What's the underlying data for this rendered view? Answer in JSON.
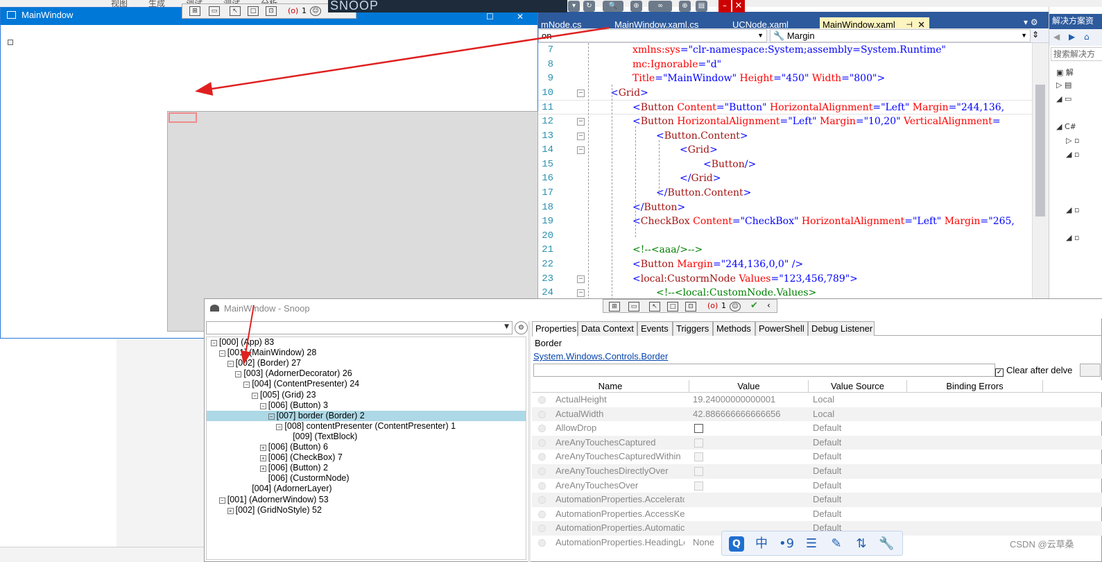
{
  "background": {
    "menu_items": [
      "视图",
      "生成",
      "调试",
      "测试",
      "分析"
    ]
  },
  "snoop_banner": {
    "title": "SNOOP"
  },
  "main_window": {
    "title": "MainWindow"
  },
  "vs": {
    "tabs": [
      {
        "label": "mNode.cs",
        "active": false
      },
      {
        "label": "MainWindow.xaml.cs",
        "active": false
      },
      {
        "label": "UCNode.xaml",
        "active": false
      },
      {
        "label": "MainWindow.xaml",
        "active": true
      }
    ],
    "active_tab_pin": "⊣",
    "active_tab_close": "✕",
    "left_dropdown": "on",
    "right_dropdown": "Margin",
    "code_lines": [
      {
        "n": "7",
        "fold": false
      },
      {
        "n": "8",
        "fold": false
      },
      {
        "n": "9",
        "fold": false
      },
      {
        "n": "10",
        "fold": true
      },
      {
        "n": "11",
        "fold": false
      },
      {
        "n": "12",
        "fold": true
      },
      {
        "n": "13",
        "fold": true
      },
      {
        "n": "14",
        "fold": true
      },
      {
        "n": "15",
        "fold": false
      },
      {
        "n": "16",
        "fold": false
      },
      {
        "n": "17",
        "fold": false
      },
      {
        "n": "18",
        "fold": false
      },
      {
        "n": "19",
        "fold": false
      },
      {
        "n": "20",
        "fold": false
      },
      {
        "n": "21",
        "fold": false
      },
      {
        "n": "22",
        "fold": false
      },
      {
        "n": "23",
        "fold": true
      },
      {
        "n": "24",
        "fold": true
      }
    ]
  },
  "solution_explorer": {
    "title": "解决方案资",
    "search_placeholder": "搜索解决方"
  },
  "snoop": {
    "window_title": "MainWindow - Snoop",
    "tree": [
      {
        "indent": 0,
        "exp": "⊟",
        "text": "[000]  (App) 83"
      },
      {
        "indent": 1,
        "exp": "⊟",
        "text": "[001]  (MainWindow) 28"
      },
      {
        "indent": 2,
        "exp": "⊟",
        "text": "[002]  (Border) 27"
      },
      {
        "indent": 3,
        "exp": "⊟",
        "text": "[003]  (AdornerDecorator) 26"
      },
      {
        "indent": 4,
        "exp": "⊟",
        "text": "[004]  (ContentPresenter) 24"
      },
      {
        "indent": 5,
        "exp": "⊟",
        "text": "[005]  (Grid) 23"
      },
      {
        "indent": 6,
        "exp": "⊟",
        "text": "[006]  (Button) 3"
      },
      {
        "indent": 7,
        "exp": "⊟",
        "text": "[007] border (Border) 2",
        "selected": true
      },
      {
        "indent": 8,
        "exp": "⊟",
        "text": "[008] contentPresenter (ContentPresenter) 1"
      },
      {
        "indent": 9,
        "exp": "",
        "text": "[009]  (TextBlock)"
      },
      {
        "indent": 6,
        "exp": "⊞",
        "text": "[006]  (Button) 6"
      },
      {
        "indent": 6,
        "exp": "⊞",
        "text": "[006]  (CheckBox) 7"
      },
      {
        "indent": 6,
        "exp": "⊞",
        "text": "[006]  (Button) 2"
      },
      {
        "indent": 6,
        "exp": "",
        "text": "[006]  (CustormNode)"
      },
      {
        "indent": 4,
        "exp": "",
        "text": "[004]  (AdornerLayer)"
      },
      {
        "indent": 1,
        "exp": "⊟",
        "text": "[001]  (AdornerWindow) 53"
      },
      {
        "indent": 2,
        "exp": "⊞",
        "text": "[002]  (GridNoStyle) 52"
      }
    ],
    "tabs": [
      "Properties",
      "Data Context",
      "Events",
      "Triggers",
      "Methods",
      "PowerShell",
      "Debug Listener"
    ],
    "selected_type": "Border",
    "type_link": "System.Windows.Controls.Border",
    "clear_after_delve": "Clear after delve",
    "columns": [
      "Name",
      "Value",
      "Value Source",
      "Binding Errors"
    ],
    "properties": [
      {
        "name": "ActualHeight",
        "value": "19.24000000000001",
        "source": "Local",
        "kind": "text"
      },
      {
        "name": "ActualWidth",
        "value": "42.886666666666656",
        "source": "Local",
        "kind": "text"
      },
      {
        "name": "AllowDrop",
        "value": "",
        "source": "Default",
        "kind": "checkbox"
      },
      {
        "name": "AreAnyTouchesCaptured",
        "value": "",
        "source": "Default",
        "kind": "checkbox-disabled"
      },
      {
        "name": "AreAnyTouchesCapturedWithin",
        "value": "",
        "source": "Default",
        "kind": "checkbox-disabled"
      },
      {
        "name": "AreAnyTouchesDirectlyOver",
        "value": "",
        "source": "Default",
        "kind": "checkbox-disabled"
      },
      {
        "name": "AreAnyTouchesOver",
        "value": "",
        "source": "Default",
        "kind": "checkbox-disabled"
      },
      {
        "name": "AutomationProperties.Acceleratc",
        "value": "",
        "source": "Default",
        "kind": "text"
      },
      {
        "name": "AutomationProperties.AccessKey",
        "value": "",
        "source": "Default",
        "kind": "text"
      },
      {
        "name": "AutomationProperties.Automatic",
        "value": "",
        "source": "Default",
        "kind": "text"
      },
      {
        "name": "AutomationProperties.HeadingLe",
        "value": "None",
        "source": "",
        "kind": "text"
      }
    ],
    "toolbar_count": "1"
  },
  "ime_toolbar": {
    "buttons": [
      "Q",
      "中",
      "•9",
      "☰",
      "✎",
      "⇅",
      "🔧"
    ]
  },
  "watermark": "CSDN @云草桑"
}
